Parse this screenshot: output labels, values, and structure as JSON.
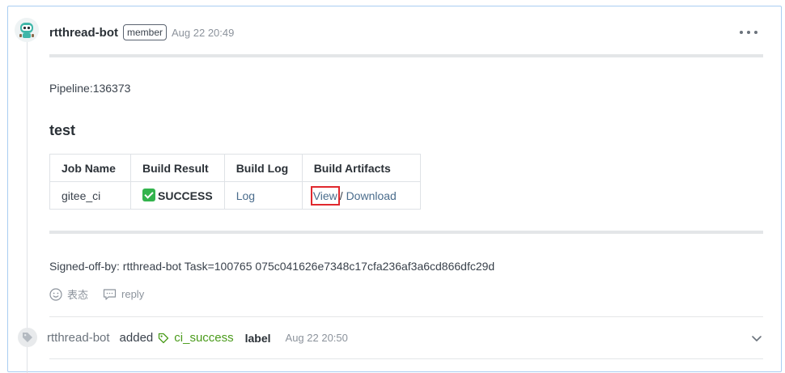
{
  "comment": {
    "author": "rtthread-bot",
    "role": "member",
    "timestamp": "Aug 22 20:49",
    "pipeline": "Pipeline:136373",
    "heading": "test",
    "table": {
      "headers": [
        "Job Name",
        "Build Result",
        "Build Log",
        "Build Artifacts"
      ],
      "row": {
        "job_name": "gitee_ci",
        "build_result": "SUCCESS",
        "build_log": "Log",
        "view": "View",
        "separator": "/",
        "download": "Download"
      }
    },
    "signed_off": "Signed-off-by: rtthread-bot Task=100765 075c041626e7348c17cfa236af3a6cd866dfc29d",
    "actions": {
      "react_label": "表态",
      "reply_label": "reply"
    }
  },
  "event": {
    "author": "rtthread-bot",
    "action": "added",
    "label_name": "ci_success",
    "label_word": "label",
    "timestamp": "Aug 22 20:50"
  },
  "icons": {
    "avatar": "robot-avatar",
    "more": "more-horizontal-icon",
    "success": "check-mark-icon",
    "emoji": "smile-icon",
    "reply": "comment-icon",
    "event": "tag-icon",
    "label": "tag-icon",
    "expand": "chevron-down-icon"
  },
  "colors": {
    "accent_link": "#4a6c8c",
    "label_green": "#4a9b1b",
    "success_green": "#33b34d",
    "highlight_red": "#e0282e",
    "frame_blue": "#a9cdf2"
  }
}
